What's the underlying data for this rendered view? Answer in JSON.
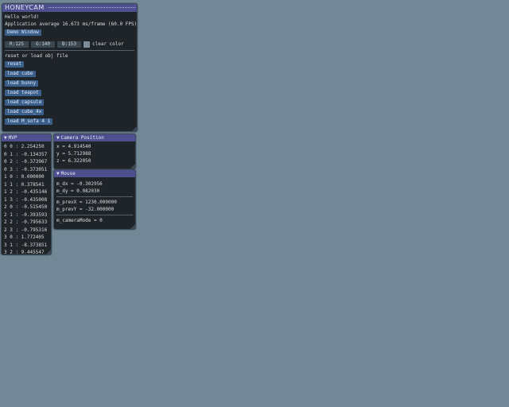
{
  "main_window": {
    "title": "HONEYCAM",
    "hello": "Hello world!",
    "perf": "Application average 16.673 ms/frame (60.0 FPS)",
    "demo_button": "Demo Window",
    "color": {
      "r": "R:125",
      "g": "G:140",
      "b": "B:153",
      "swatch": "#7d8c99",
      "label": "clear color"
    },
    "reset_label": "reset or load obj file",
    "buttons": [
      "reset",
      "load cube",
      "load bunny",
      "load teapot",
      "load capsule",
      "load cube_4x",
      "load M_sofa 4 1"
    ]
  },
  "mvp_window": {
    "title": "MVP",
    "rows": [
      "0 0 : 2.254250",
      "0 1 : -0.134357",
      "0 2 : -0.373967",
      "0 3 : -0.373051",
      "1 0 : 0.000000",
      "1 1 : 0.378541",
      "1 2 : -0.435146",
      "1 3 : -0.435008",
      "2 0 : -0.515450",
      "2 1 : -0.393593",
      "2 2 : -0.795633",
      "2 3 : -0.795316",
      "3 0 : 1.772405",
      "3 1 : -8.373851",
      "3 2 : 9.445547",
      "3 3 : 9.448457"
    ]
  },
  "camera_window": {
    "title": "Camera Position",
    "x": "x = 4.914540",
    "y": "y = 5.712988",
    "z": "z = 6.322050"
  },
  "mouse_window": {
    "title": "Mouse",
    "dx": "m_dx = -0.302956",
    "dy": "m_dy = 0.082030",
    "prevx": "m_prevX = 1230.000000",
    "prevy": "m_prevY = -32.000000",
    "cammode": "m_cameraMode = 0"
  }
}
